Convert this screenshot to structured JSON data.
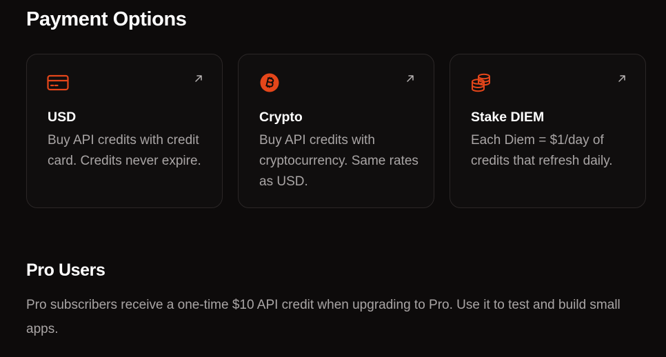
{
  "payment_section": {
    "title": "Payment Options",
    "cards": [
      {
        "icon": "credit-card-icon",
        "title": "USD",
        "description": "Buy API credits with credit card. Credits never expire.",
        "link_icon": "arrow-up-right-icon"
      },
      {
        "icon": "bitcoin-icon",
        "title": "Crypto",
        "description": "Buy API credits with cryptocurrency. Same rates as USD.",
        "link_icon": "arrow-up-right-icon"
      },
      {
        "icon": "coins-stack-icon",
        "title": "Stake DIEM",
        "description": "Each Diem = $1/day of credits that refresh daily.",
        "link_icon": "arrow-up-right-icon"
      }
    ]
  },
  "pro_section": {
    "title": "Pro Users",
    "description": "Pro subscribers receive a one-time $10 API credit when upgrading to Pro. Use it to test and build small apps."
  },
  "colors": {
    "background": "#0d0b0b",
    "card_border": "#2b2727",
    "accent": "#e5461a",
    "text_primary": "#ffffff",
    "text_secondary": "#a9a5a5"
  }
}
